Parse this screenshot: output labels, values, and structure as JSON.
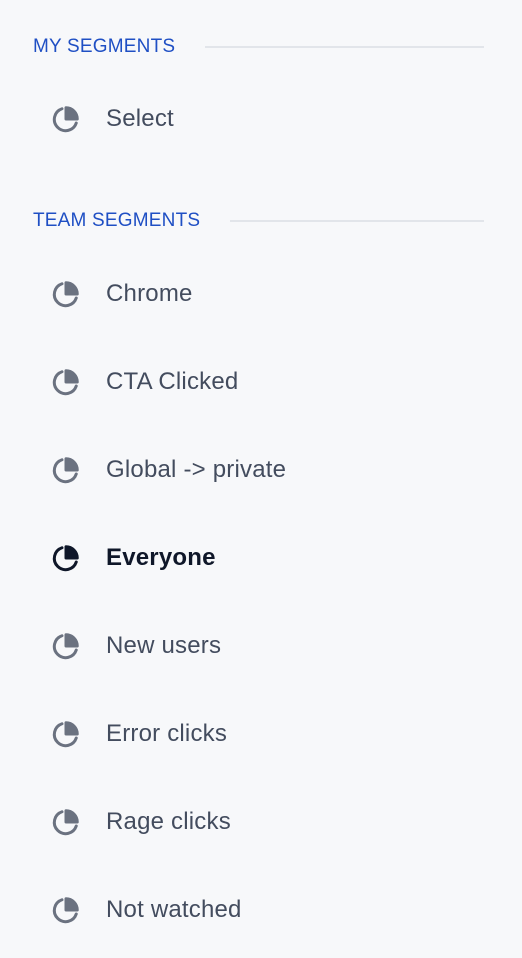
{
  "my_segments": {
    "title": "MY SEGMENTS",
    "items": [
      {
        "label": "Select",
        "icon": "pie-chart-icon",
        "active": false
      }
    ]
  },
  "team_segments": {
    "title": "TEAM SEGMENTS",
    "items": [
      {
        "label": "Chrome",
        "icon": "pie-chart-icon",
        "active": false
      },
      {
        "label": "CTA Clicked",
        "icon": "pie-chart-icon",
        "active": false
      },
      {
        "label": "Global -> private",
        "icon": "pie-chart-icon",
        "active": false
      },
      {
        "label": "Everyone",
        "icon": "pie-chart-icon",
        "active": true
      },
      {
        "label": "New users",
        "icon": "pie-chart-icon",
        "active": false
      },
      {
        "label": "Error clicks",
        "icon": "pie-chart-icon",
        "active": false
      },
      {
        "label": "Rage clicks",
        "icon": "pie-chart-icon",
        "active": false
      },
      {
        "label": "Not watched",
        "icon": "pie-chart-icon",
        "active": false
      }
    ]
  },
  "colors": {
    "section_title": "#1f4fc4",
    "icon_inactive": "#6b7280",
    "icon_active": "#0f1729",
    "label_inactive": "#434c5e",
    "label_active": "#0f1729"
  }
}
